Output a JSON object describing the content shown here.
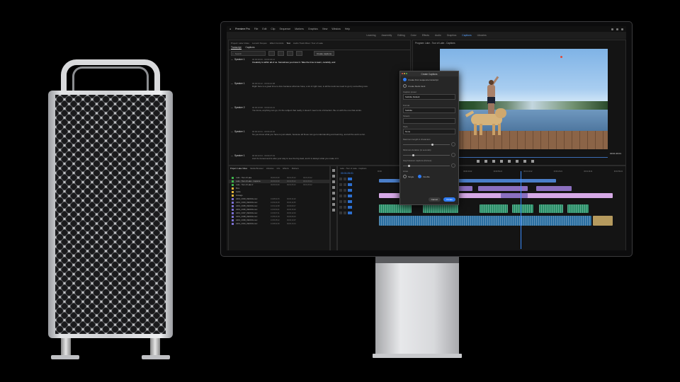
{
  "menubar": {
    "app": "Premiere Pro",
    "items": [
      "File",
      "Edit",
      "Clip",
      "Sequence",
      "Markers",
      "Graphics",
      "View",
      "Window",
      "Help"
    ]
  },
  "workspaces": {
    "items": [
      "Learning",
      "Assembly",
      "Editing",
      "Color",
      "Effects",
      "Audio",
      "Graphics",
      "Captions",
      "Libraries"
    ],
    "active": "Captions"
  },
  "text_panel": {
    "tabs": [
      "Project: Lake Video",
      "Lumetri Scopes",
      "Effect Controls",
      "Text",
      "Audio Track Mixer: Tour of Lake"
    ],
    "subtabs": [
      "Transcript",
      "Captions"
    ],
    "search_placeholder": "Search",
    "create_captions_label": "Create captions",
    "segments": [
      {
        "speaker": "Speaker 1",
        "time": "00:00:00:00 - 00:00:04:12",
        "text": "Creativity is within all of us. Sometimes you know it. Take the time to learn, carefully, and"
      },
      {
        "speaker": "Speaker 1",
        "time": "00:00:04:12 - 00:00:10:08",
        "text": "Right here is a great time to dive because what we have, a lot of right now, is all the tools we need to go try something new."
      },
      {
        "speaker": "Speaker 2",
        "time": "00:00:10:08 - 00:00:16:21",
        "text": "You know, anything can go; it's the subject that really, it doesn't need a lot of direction. Be on with the one that works."
      },
      {
        "speaker": "Speaker 1",
        "time": "00:00:16:21 - 00:00:22:04",
        "text": "So you know what you have to just attack, because all these can get understanding and learning, and all the work so far."
      },
      {
        "speaker": "Speaker 1",
        "time": "00:00:22:04 - 00:00:27:19",
        "text": "And it's honest and is also your way to see the big deal, and it is always what you make of it."
      }
    ]
  },
  "program": {
    "title": "Program: Lake - Tour of Lake - Captions",
    "timecode": "00:01:26:01"
  },
  "dialog": {
    "title": "Create Captions",
    "option1": "Create from sequence transcript",
    "option2": "Create blank track",
    "preset_label": "Caption preset",
    "preset_value": "Subtitle Default",
    "format_label": "Format",
    "format_value": "Subtitle",
    "stream_label": "Stream",
    "stream_value": "",
    "style_label": "Style",
    "style_value": "None",
    "max_length_label": "Maximum length in characters",
    "min_duration_label": "Minimum duration (in seconds)",
    "gap_label": "Gap between captions (frames)",
    "lines_label": "Lines",
    "lines_single": "Single",
    "lines_double": "Double",
    "cancel": "Cancel",
    "create": "Create"
  },
  "project_panel": {
    "tabs": [
      "Project: Lake Video",
      "Media Browser",
      "Libraries",
      "Info",
      "Effects",
      "Markers"
    ],
    "rows": [
      {
        "name": "Lake - Tour of Lake",
        "color": "#3db14a",
        "c2": "00;00;00;00",
        "c3": "00;01;33;12",
        "c4": "00;01;33;12"
      },
      {
        "name": "Lake - Tour of Lake - Captions",
        "color": "#3db14a",
        "c2": "00;00;00;00",
        "c3": "00;01;33;12",
        "c4": "00;01;33;12"
      },
      {
        "name": "Lake - Tour of Lake 2",
        "color": "#3db14a",
        "c2": "00;00;00;00",
        "c3": "00;01;33;12",
        "c4": "00;01;33;12"
      },
      {
        "name": "Bins",
        "color": "#e0b23a",
        "c2": "",
        "c3": "",
        "c4": ""
      },
      {
        "name": "Audio",
        "color": "#e0b23a",
        "c2": "",
        "c3": "",
        "c4": ""
      },
      {
        "name": "Footage",
        "color": "#e0b23a",
        "c2": "",
        "c3": "",
        "c4": ""
      },
      {
        "name": "A001_C003_0322UG.mov",
        "color": "#7a6fd0",
        "c2": "13;28;02;15",
        "c3": "00;00;14;22",
        "c4": ""
      },
      {
        "name": "A001_C004_0322UG.mov",
        "color": "#7a6fd0",
        "c2": "13;29;44;03",
        "c3": "00;00;11;05",
        "c4": ""
      },
      {
        "name": "A001_C005_0322UG.mov",
        "color": "#7a6fd0",
        "c2": "13;31;12;08",
        "c3": "00;00;09;17",
        "c4": ""
      },
      {
        "name": "A001_C006_0322UG.mov",
        "color": "#7a6fd0",
        "c2": "13;32;50;21",
        "c3": "00;00;16;02",
        "c4": ""
      },
      {
        "name": "A001_C007_0322UG.mov",
        "color": "#7a6fd0",
        "c2": "13;34;07;11",
        "c3": "00;00;12;40",
        "c4": ""
      },
      {
        "name": "A001_C008_0322UG.mov",
        "color": "#7a6fd0",
        "c2": "13;35;21;04",
        "c3": "00;00;08;19",
        "c4": ""
      },
      {
        "name": "A001_C009_0322UG.mov",
        "color": "#7a6fd0",
        "c2": "13;36;45;12",
        "c3": "00;00;10;07",
        "c4": ""
      },
      {
        "name": "A001_C010_0322UG.mov",
        "color": "#7a6fd0",
        "c2": "13;38;02;09",
        "c3": "00;00;13;14",
        "c4": ""
      }
    ]
  },
  "timeline": {
    "tabs": [
      "Lake - Tour of Lake - Captions"
    ],
    "timecode": "00:01:26:01",
    "ruler": [
      "00:00",
      "00:00:14:23",
      "00:00:29:23",
      "00:00:44:22",
      "00:00:59:22",
      "00:01:14:22",
      "00:01:29:21",
      "00:01:44:21",
      "00:01:59:21"
    ]
  }
}
